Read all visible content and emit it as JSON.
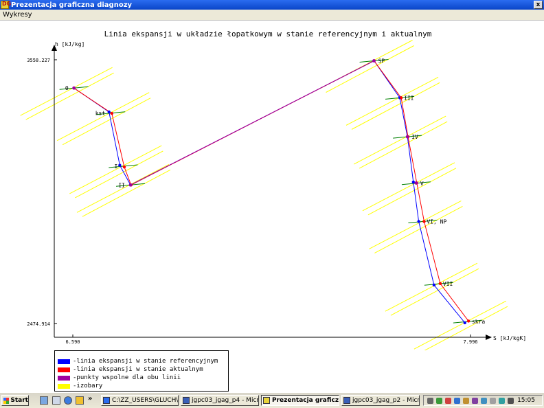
{
  "window": {
    "title": "Prezentacja graficzna diagnozy",
    "icon": "DG",
    "close_label": "x"
  },
  "menu": {
    "items": [
      "Wykresy"
    ]
  },
  "chart_data": {
    "type": "line",
    "title": "Linia ekspansji w układzie łopatkowym w stanie referencyjnym i aktualnym",
    "xlabel": "S [kJ/kgK]",
    "ylabel": "h [kJ/kg]",
    "xlim": [
      6.59,
      7.996
    ],
    "ylim": [
      2474.914,
      3558.227
    ],
    "x_ticks": [
      "6.590",
      "7.996"
    ],
    "y_ticks": [
      "3558.227",
      "2474.914"
    ],
    "colors": {
      "reference": "#0000ff",
      "actual": "#ff0000",
      "common": "#a000a0",
      "isobar": "#ffff00",
      "local_isobar": "#008000"
    },
    "points": [
      {
        "label": "0",
        "x": 6.594,
        "y": 3442
      },
      {
        "label": "kst",
        "x": 6.724,
        "y": 3339
      },
      {
        "label": "I",
        "x": 6.768,
        "y": 3121
      },
      {
        "label": "II",
        "x": 6.794,
        "y": 3044
      },
      {
        "label": "SP",
        "x": 7.655,
        "y": 3554
      },
      {
        "label": "III",
        "x": 7.746,
        "y": 3402
      },
      {
        "label": "IV",
        "x": 7.773,
        "y": 3242
      },
      {
        "label": "V",
        "x": 7.804,
        "y": 3051
      },
      {
        "label": "VI, NP",
        "x": 7.827,
        "y": 2894
      },
      {
        "label": "VII",
        "x": 7.884,
        "y": 2638
      },
      {
        "label": "skra",
        "x": 7.986,
        "y": 2483
      }
    ],
    "series": [
      {
        "name": "linia ekspansji w stanie referencyjnym",
        "points": [
          {
            "x": 6.594,
            "y": 3442
          },
          {
            "x": 6.718,
            "y": 3344
          },
          {
            "x": 6.756,
            "y": 3125
          },
          {
            "x": 6.794,
            "y": 3044
          },
          {
            "x": 7.655,
            "y": 3554
          },
          {
            "x": 7.746,
            "y": 3402
          },
          {
            "x": 7.773,
            "y": 3242
          },
          {
            "x": 7.794,
            "y": 3056
          },
          {
            "x": 7.813,
            "y": 2894
          },
          {
            "x": 7.867,
            "y": 2633
          },
          {
            "x": 7.976,
            "y": 2478
          }
        ]
      },
      {
        "name": "linia ekspansji w stanie aktualnym",
        "points": [
          {
            "x": 6.594,
            "y": 3442
          },
          {
            "x": 6.728,
            "y": 3338
          },
          {
            "x": 6.772,
            "y": 3118
          },
          {
            "x": 6.796,
            "y": 3044
          },
          {
            "x": 7.655,
            "y": 3554
          },
          {
            "x": 7.751,
            "y": 3402
          },
          {
            "x": 7.775,
            "y": 3242
          },
          {
            "x": 7.806,
            "y": 3052
          },
          {
            "x": 7.832,
            "y": 2894
          },
          {
            "x": 7.889,
            "y": 2639
          },
          {
            "x": 7.989,
            "y": 2485
          }
        ]
      }
    ],
    "common_points": [
      {
        "x": 6.594,
        "y": 3442
      },
      {
        "x": 6.794,
        "y": 3044
      },
      {
        "x": 7.655,
        "y": 3554
      },
      {
        "x": 7.773,
        "y": 3242
      },
      {
        "x": 7.804,
        "y": 3052
      }
    ],
    "legend": {
      "placement": "bottom-left",
      "items": [
        {
          "label": "-linia ekspansji w stanie referencyjnym",
          "color": "#0000ff"
        },
        {
          "label": "-linia ekspansji w stanie aktualnym",
          "color": "#ff0000"
        },
        {
          "label": "-punkty wspolne dla obu linii",
          "color": "#a000a0"
        },
        {
          "label": "-izobary",
          "color": "#ffff00"
        }
      ]
    }
  },
  "taskbar": {
    "start_label": "Start",
    "chevron": "»",
    "quick_launch_icons": [
      "desktop-icon",
      "window-icon",
      "ie-icon",
      "media-icon"
    ],
    "tasks": [
      {
        "label": "C:\\ZZ_USERS\\GLUCH\\...",
        "icon": "folder-icon",
        "active": false
      },
      {
        "label": "jgpc03_jgag_p4 - Micr...",
        "icon": "word-icon",
        "active": false
      },
      {
        "label": "Prezentacja graficzn...",
        "icon": "app-icon",
        "active": true
      },
      {
        "label": "jgpc03_jgag_p2 - Micr...",
        "icon": "word-icon",
        "active": false
      }
    ],
    "clock": "15:05"
  }
}
